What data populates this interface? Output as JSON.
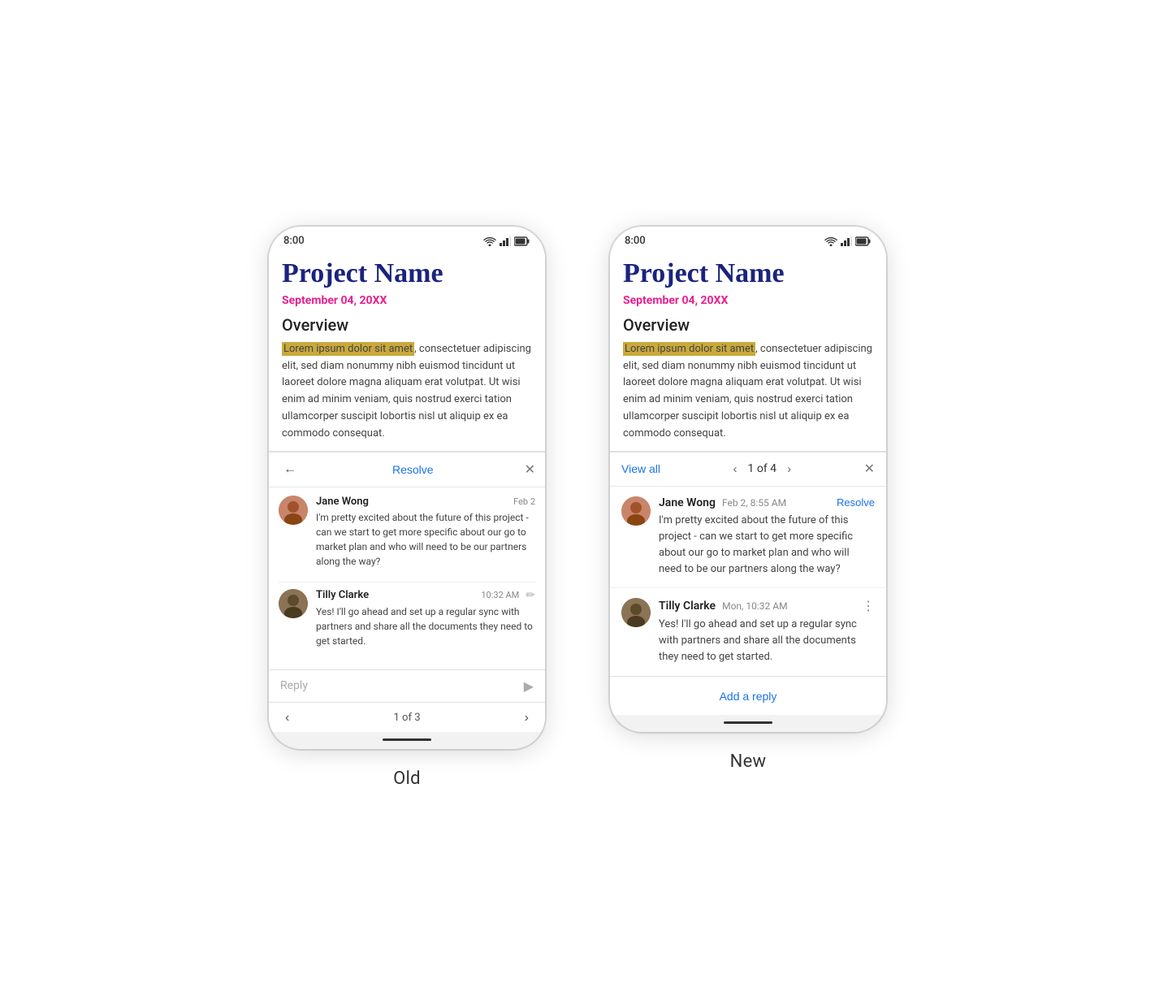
{
  "page": {
    "bg": "#ffffff"
  },
  "labels": {
    "old": "Old",
    "new": "New"
  },
  "status_bar": {
    "time": "8:00"
  },
  "document": {
    "title": "Project Name",
    "date": "September 04, 20XX",
    "overview_heading": "Overview",
    "overview_text_highlighted": "Lorem ipsum dolor sit amet",
    "overview_text_rest": ", consectetuer adipiscing elit, sed diam nonummy nibh euismod tincidunt ut laoreet dolore magna aliquam erat volutpat. Ut wisi enim ad minim veniam, quis nostrud exerci tation ullamcorper suscipit lobortis nisl ut aliquip ex ea commodo consequat."
  },
  "old_panel": {
    "back_label": "←",
    "resolve_label": "Resolve",
    "close_label": "✕",
    "comment1": {
      "author": "Jane Wong",
      "time": "Feb 2",
      "text": "I'm pretty excited about the future of this project - can we start to get more specific about our go to market plan and who will need to be our partners along the way?"
    },
    "comment2": {
      "author": "Tilly Clarke",
      "time": "10:32 AM",
      "text": "Yes! I'll go ahead and set up a regular sync with partners and share all the documents they need to get started."
    },
    "reply_placeholder": "Reply",
    "pagination": "1 of 3",
    "prev_label": "‹",
    "next_label": "›"
  },
  "new_panel": {
    "view_all_label": "View all",
    "close_label": "✕",
    "prev_label": "‹",
    "next_label": "›",
    "pagination": "1 of 4",
    "comment1": {
      "author": "Jane Wong",
      "time": "Feb 2, 8:55 AM",
      "resolve_label": "Resolve",
      "text": "I'm pretty excited about the future of this project - can we start to get more specific about our go to market plan and who will need to be our partners along the way?"
    },
    "comment2": {
      "author": "Tilly Clarke",
      "time": "Mon, 10:32 AM",
      "text": "Yes! I'll go ahead and set up a regular sync with partners and share all the documents they need to get started."
    },
    "add_reply_label": "Add a reply"
  }
}
